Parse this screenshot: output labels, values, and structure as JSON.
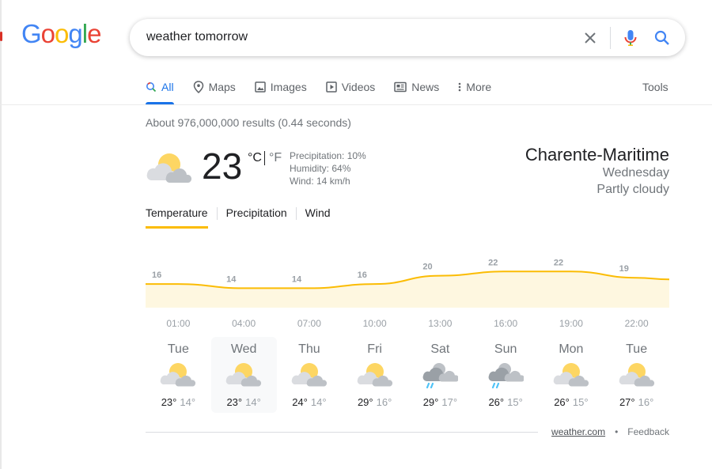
{
  "logo": {
    "letters": [
      "G",
      "o",
      "o",
      "g",
      "l",
      "e"
    ],
    "colors": [
      "#4285f4",
      "#ea4335",
      "#fbbc05",
      "#4285f4",
      "#34a853",
      "#ea4335"
    ]
  },
  "search": {
    "query": "weather tomorrow"
  },
  "tabs": [
    {
      "label": "All",
      "icon": "search-icon"
    },
    {
      "label": "Maps",
      "icon": "map-pin-icon"
    },
    {
      "label": "Images",
      "icon": "image-icon"
    },
    {
      "label": "Videos",
      "icon": "video-icon"
    },
    {
      "label": "News",
      "icon": "news-icon"
    },
    {
      "label": "More",
      "icon": "more-vertical-icon"
    }
  ],
  "tools_label": "Tools",
  "result_stats": "About 976,000,000 results (0.44 seconds)",
  "weather": {
    "temperature": "23",
    "unit_c": "°C",
    "unit_f": "°F",
    "precipitation": "Precipitation: 10%",
    "humidity": "Humidity: 64%",
    "wind": "Wind: 14 km/h",
    "location": "Charente-Maritime",
    "day": "Wednesday",
    "condition": "Partly cloudy"
  },
  "chart_tabs": [
    "Temperature",
    "Precipitation",
    "Wind"
  ],
  "chart_data": {
    "type": "area",
    "x": [
      "01:00",
      "04:00",
      "07:00",
      "10:00",
      "13:00",
      "16:00",
      "19:00",
      "22:00"
    ],
    "values": [
      16,
      14,
      14,
      16,
      20,
      22,
      22,
      19
    ],
    "ylim": [
      10,
      24
    ],
    "line_color": "#fbbc04",
    "fill_color": "#fef7e0"
  },
  "forecast": [
    {
      "day": "Tue",
      "hi": "23°",
      "lo": "14°",
      "icon": "partly-cloudy-icon"
    },
    {
      "day": "Wed",
      "hi": "23°",
      "lo": "14°",
      "icon": "partly-cloudy-icon"
    },
    {
      "day": "Thu",
      "hi": "24°",
      "lo": "14°",
      "icon": "partly-cloudy-icon"
    },
    {
      "day": "Fri",
      "hi": "29°",
      "lo": "16°",
      "icon": "partly-cloudy-icon"
    },
    {
      "day": "Sat",
      "hi": "29°",
      "lo": "17°",
      "icon": "rain-icon"
    },
    {
      "day": "Sun",
      "hi": "26°",
      "lo": "15°",
      "icon": "rain-icon"
    },
    {
      "day": "Mon",
      "hi": "26°",
      "lo": "15°",
      "icon": "partly-cloudy-icon"
    },
    {
      "day": "Tue",
      "hi": "27°",
      "lo": "16°",
      "icon": "partly-cloudy-icon"
    }
  ],
  "footer": {
    "source": "weather.com",
    "separator": "•",
    "feedback": "Feedback"
  }
}
